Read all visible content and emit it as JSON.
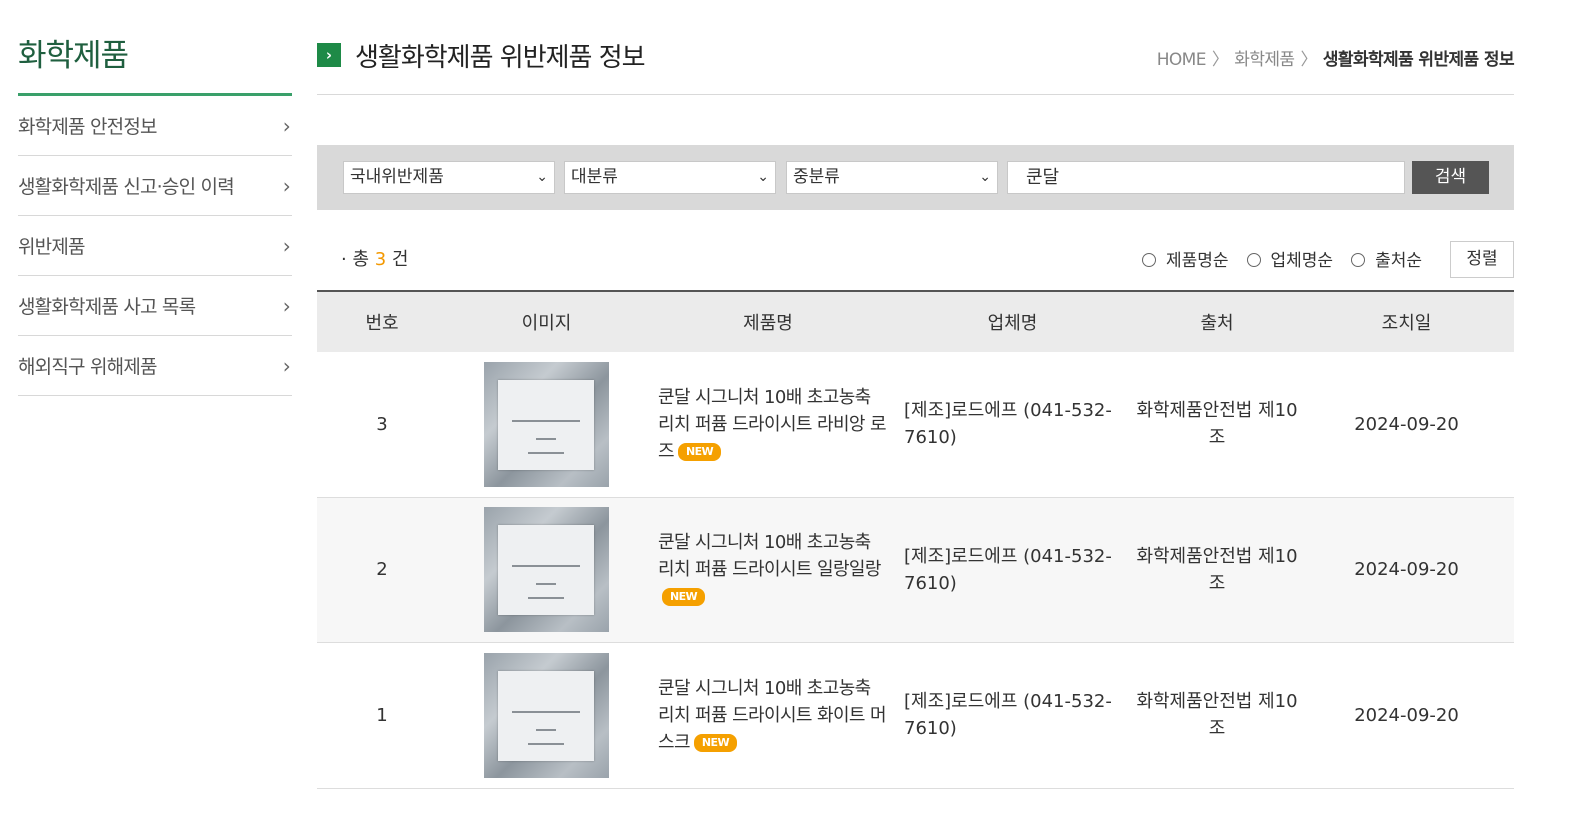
{
  "sidebar": {
    "title": "화학제품",
    "items": [
      {
        "label": "화학제품 안전정보"
      },
      {
        "label": "생활화학제품 신고·승인 이력"
      },
      {
        "label": "위반제품"
      },
      {
        "label": "생활화학제품 사고 목록"
      },
      {
        "label": "해외직구 위해제품"
      }
    ]
  },
  "header": {
    "title": "생활화학제품 위반제품 정보",
    "breadcrumb": [
      "HOME",
      "화학제품",
      "생활화학제품 위반제품 정보"
    ]
  },
  "search": {
    "select1": "국내위반제품",
    "select2": "대분류",
    "select3": "중분류",
    "query": "쿤달",
    "button": "검색"
  },
  "results": {
    "prefix": "· 총 ",
    "count": "3",
    "suffix": " 건",
    "sort_options": [
      "제품명순",
      "업체명순",
      "출처순"
    ],
    "sort_button": "정렬"
  },
  "table": {
    "columns": [
      "번호",
      "이미지",
      "제품명",
      "업체명",
      "출처",
      "조치일"
    ],
    "rows": [
      {
        "no": "3",
        "name": "쿤달 시그니처 10배 초고농축 리치 퍼퓸 드라이시트 라비앙 로즈",
        "badge": "NEW",
        "company": "[제조]로드에프 (041-532-7610)",
        "source": "화학제품안전법 제10조",
        "date": "2024-09-20"
      },
      {
        "no": "2",
        "name": "쿤달 시그니처 10배 초고농축 리치 퍼퓸 드라이시트 일랑일랑",
        "badge": "NEW",
        "company": "[제조]로드에프 (041-532-7610)",
        "source": "화학제품안전법 제10조",
        "date": "2024-09-20"
      },
      {
        "no": "1",
        "name": "쿤달 시그니처 10배 초고농축 리치 퍼퓸 드라이시트 화이트 머스크",
        "badge": "NEW",
        "company": "[제조]로드에프 (041-532-7610)",
        "source": "화학제품안전법 제10조",
        "date": "2024-09-20"
      }
    ]
  }
}
